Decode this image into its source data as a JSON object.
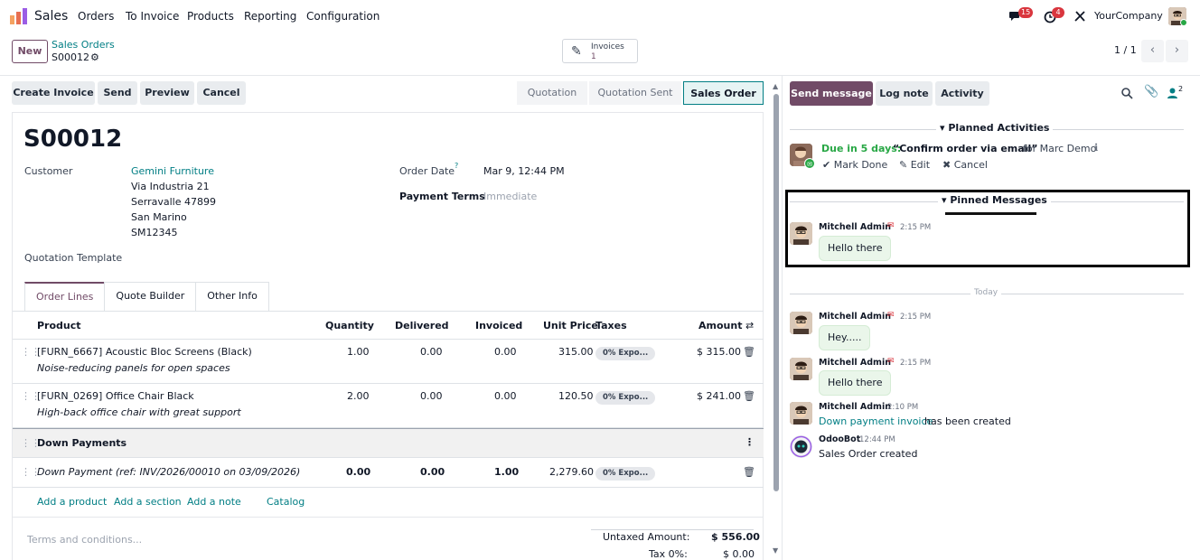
{
  "topbar": {
    "app_name": "Sales",
    "menu": [
      "Orders",
      "To Invoice",
      "Products",
      "Reporting",
      "Configuration"
    ],
    "messages_badge": "15",
    "activities_badge": "4",
    "company": "YourCompany"
  },
  "control": {
    "new_label": "New",
    "breadcrumb_parent": "Sales Orders",
    "breadcrumb_current": "S00012",
    "smart_button_label": "Invoices",
    "smart_button_count": "1",
    "pager": "1 / 1"
  },
  "actions": {
    "buttons": [
      "Create Invoice",
      "Send",
      "Preview",
      "Cancel"
    ],
    "stages": [
      "Quotation",
      "Quotation Sent",
      "Sales Order"
    ],
    "active_stage": "Sales Order"
  },
  "form": {
    "title": "S00012",
    "customer_label": "Customer",
    "customer_name": "Gemini Furniture",
    "customer_address": [
      "Via Industria 21",
      "Serravalle 47899",
      "San Marino",
      "SM12345"
    ],
    "order_date_label": "Order Date",
    "order_date_help": "?",
    "order_date": "Mar 9, 12:44 PM",
    "payment_terms_label": "Payment Terms",
    "payment_terms": "Immediate",
    "quotation_template_label": "Quotation Template",
    "tabs": [
      "Order Lines",
      "Quote Builder",
      "Other Info"
    ]
  },
  "lines": {
    "headers": {
      "product": "Product",
      "quantity": "Quantity",
      "delivered": "Delivered",
      "invoiced": "Invoiced",
      "unit_price": "Unit Price",
      "taxes": "Taxes",
      "amount": "Amount"
    },
    "rows": [
      {
        "product": "[FURN_6667] Acoustic Bloc Screens (Black)",
        "description": "Noise-reducing panels for open spaces",
        "quantity": "1.00",
        "delivered": "0.00",
        "invoiced": "0.00",
        "unit_price": "315.00",
        "tax": "0% Expo...",
        "amount": "$ 315.00"
      },
      {
        "product": "[FURN_0269] Office Chair Black",
        "description": "High-back office chair with great support",
        "quantity": "2.00",
        "delivered": "0.00",
        "invoiced": "0.00",
        "unit_price": "120.50",
        "tax": "0% Expo...",
        "amount": "$ 241.00"
      }
    ],
    "section": "Down Payments",
    "down_payment": {
      "description": "Down Payment (ref: INV/2026/00010 on 03/09/2026)",
      "quantity": "0.00",
      "delivered": "0.00",
      "invoiced": "1.00",
      "unit_price": "2,279.60",
      "tax": "0% Expo..."
    },
    "add_links": [
      "Add a product",
      "Add a section",
      "Add a note",
      "Catalog"
    ]
  },
  "footer": {
    "terms_placeholder": "Terms and conditions...",
    "untaxed_label": "Untaxed Amount:",
    "untaxed_value": "$ 556.00",
    "tax_label": "Tax 0%:",
    "tax_value": "$ 0.00"
  },
  "chatter": {
    "buttons": [
      "Send message",
      "Log note",
      "Activity"
    ],
    "followers_count": "2",
    "planned_title": "Planned Activities",
    "activity": {
      "due": "Due in 5 days:",
      "summary": "“Confirm order via email”",
      "for": "for Marc Demo",
      "actions": [
        "Mark Done",
        "Edit",
        "Cancel"
      ]
    },
    "pinned_title": "Pinned Messages",
    "pinned": {
      "author": "Mitchell Admin",
      "time": "2:15 PM",
      "body": "Hello there"
    },
    "today_label": "Today",
    "messages": [
      {
        "author": "Mitchell Admin",
        "time": "2:15 PM",
        "body": "Hey....."
      },
      {
        "author": "Mitchell Admin",
        "time": "2:15 PM",
        "body": "Hello there"
      }
    ],
    "notification": {
      "author": "Mitchell Admin",
      "time": "2:10 PM",
      "link": "Down payment invoice",
      "text": "has been created"
    },
    "bot": {
      "author": "OdooBot",
      "time": "12:44 PM",
      "text": "Sales Order created"
    }
  },
  "colors": {
    "brand": "#714B67",
    "link": "#017E84",
    "badge": "#d9363e"
  }
}
